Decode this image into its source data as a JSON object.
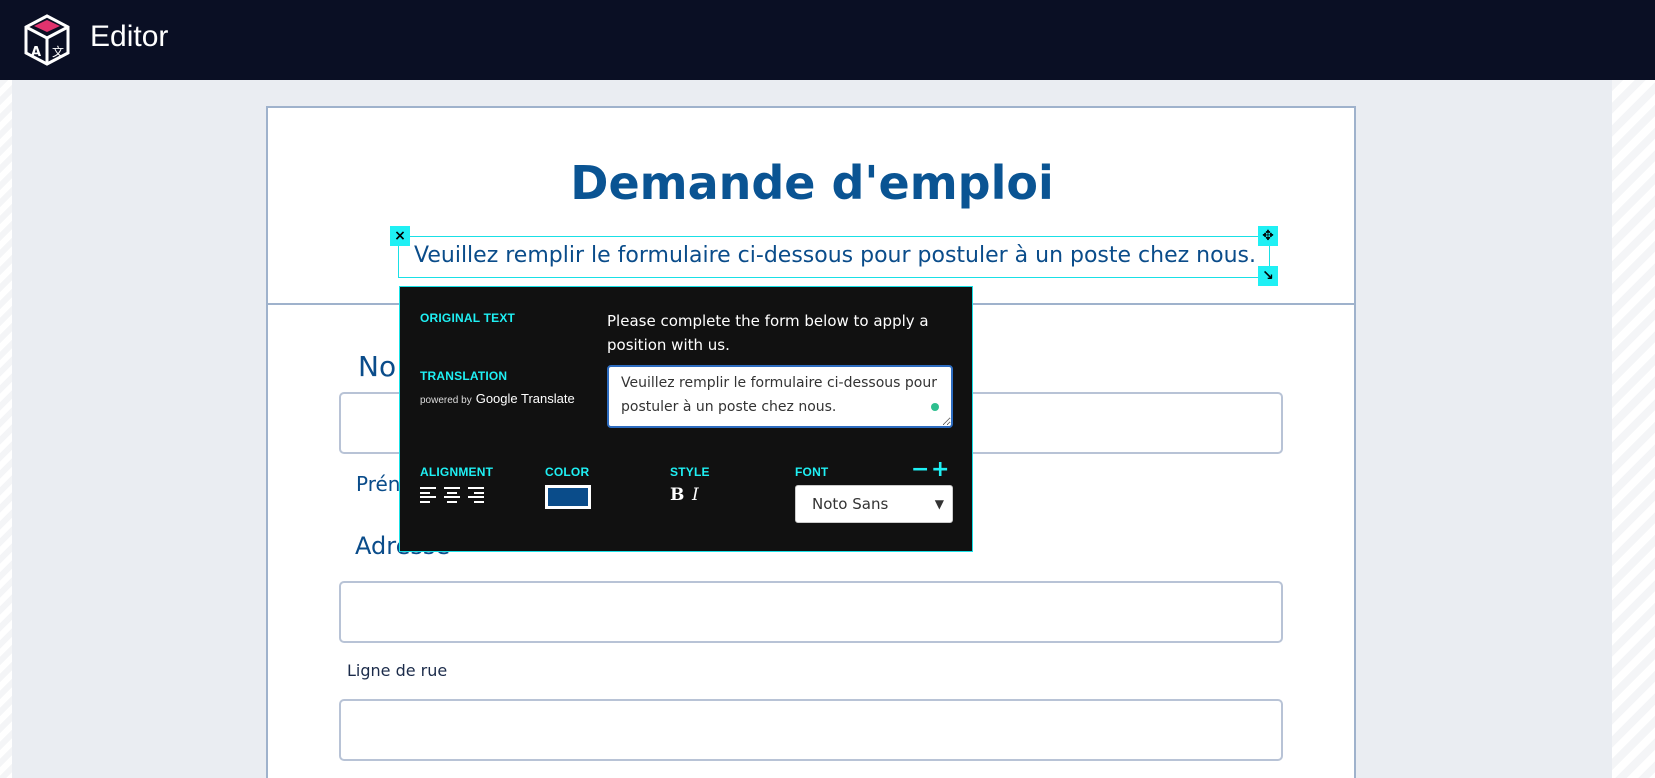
{
  "app": {
    "title": "Editor",
    "logo_icon": "cube-logo-icon"
  },
  "document": {
    "title": "Demande d'emploi",
    "subtitle": "Veuillez remplir le formulaire ci-dessous pour postuler à un poste chez nous.",
    "title_color": "#0a5493",
    "fields": {
      "nom_label": "No",
      "prenom_label": "Prén",
      "adresse_label": "Adresse",
      "ligne_label": "Ligne de rue"
    }
  },
  "selection": {
    "close": "×",
    "move": "✥",
    "resize": "↘"
  },
  "popup": {
    "original_label": "ORIGINAL TEXT",
    "original_text": "Please complete the form below to apply a position with us.",
    "translation_label": "TRANSLATION",
    "powered_by": "powered by",
    "powered_brand": "Google Translate",
    "translation_text": "Veuillez remplir le formulaire ci-dessous pour postuler à un poste chez nous.",
    "alignment_label": "ALIGNMENT",
    "color_label": "COLOR",
    "color_value": "#0a4c8a",
    "style_label": "STYLE",
    "bold": "B",
    "italic": "I",
    "font_label": "FONT",
    "font_minus": "−",
    "font_plus": "+",
    "font_value": "Noto Sans",
    "accent": "#1ff0f4"
  }
}
